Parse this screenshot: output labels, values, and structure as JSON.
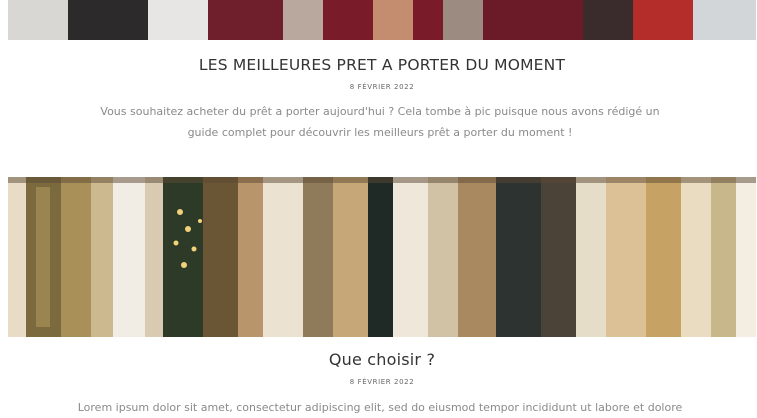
{
  "posts": [
    {
      "title": "LES MEILLEURES PRET A PORTER DU MOMENT",
      "date": "8 FÉVRIER 2022",
      "excerpt": "Vous souhaitez acheter du prêt a porter aujourd'hui ? Cela tombe à pic puisque nous avons rédigé un guide complet pour découvrir les meilleurs prêt a porter du moment !"
    },
    {
      "title": "Que choisir ?",
      "date": "8 FÉVRIER 2022",
      "excerpt": "Lorem ipsum dolor sit amet, consectetur adipiscing elit, sed do eiusmod tempor incididunt ut labore et dolore"
    }
  ],
  "colors": {
    "title": "#333333",
    "meta": "#666666",
    "excerpt": "#8a8a8a"
  }
}
